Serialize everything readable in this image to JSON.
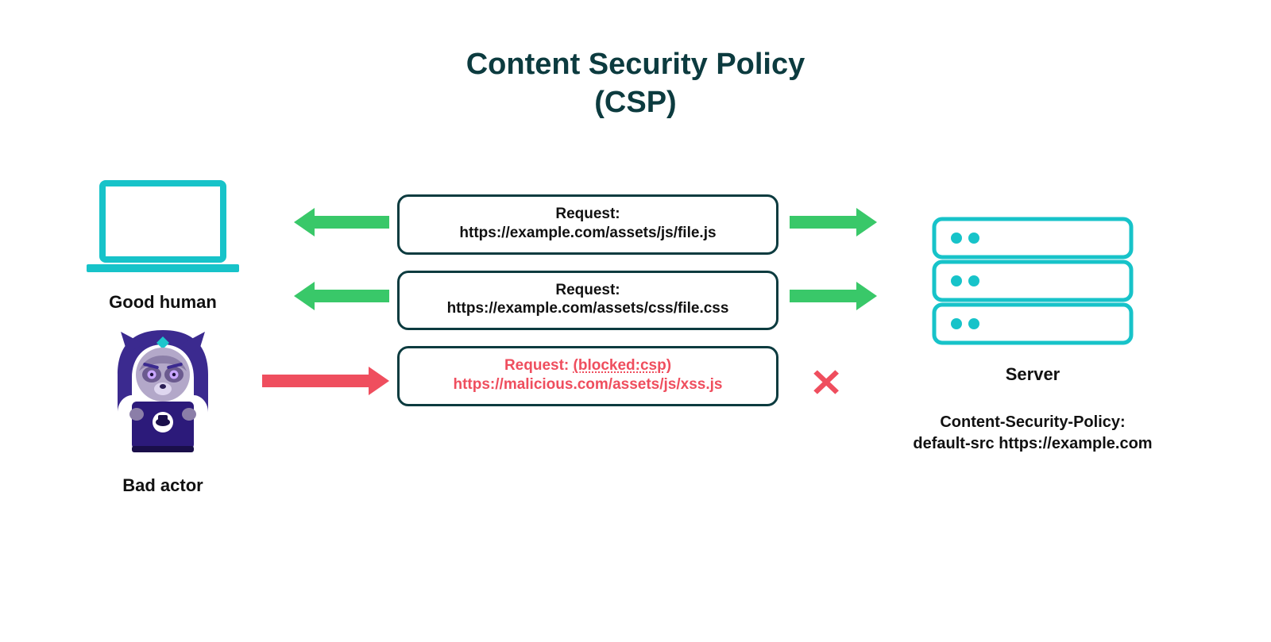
{
  "title": {
    "line1": "Content Security Policy",
    "line2": "(CSP)"
  },
  "left": {
    "good_label": "Good human",
    "bad_label": "Bad actor"
  },
  "requests": {
    "r1": {
      "label": "Request:",
      "url": "https://example.com/assets/js/file.js"
    },
    "r2": {
      "label": "Request:",
      "url": "https://example.com/assets/css/file.css"
    },
    "r3": {
      "label_prefix": "Request: ",
      "blocked_tag": "(blocked:csp)",
      "url": "https://malicious.com/assets/js/xss.js"
    }
  },
  "server": {
    "label": "Server",
    "csp_line1": "Content-Security-Policy:",
    "csp_line2": "default-src https://example.com"
  },
  "colors": {
    "teal": "#17c3c9",
    "green": "#39c869",
    "red": "#ef4e5e",
    "dark": "#0c3b3f",
    "purple": "#3b2a8f"
  }
}
